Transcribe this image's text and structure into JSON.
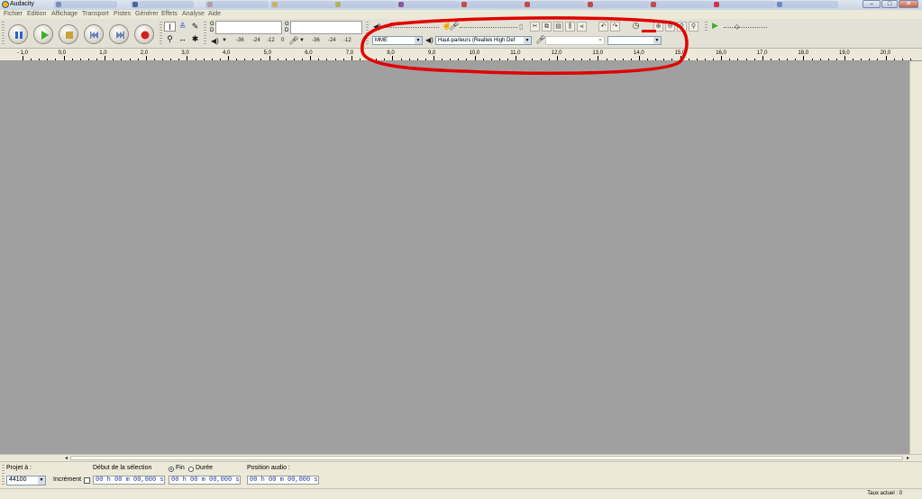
{
  "window": {
    "title": "Audacity",
    "minimize": "–",
    "maximize": "□",
    "close": "✕"
  },
  "menu": [
    {
      "label": "Fichier"
    },
    {
      "label": "Edition"
    },
    {
      "label": "Affichage"
    },
    {
      "label": "Transport"
    },
    {
      "label": "Pistes"
    },
    {
      "label": "Générer"
    },
    {
      "label": "Effets"
    },
    {
      "label": "Analyse"
    },
    {
      "label": "Aide"
    }
  ],
  "transport": {
    "pause_icon": "pause-icon",
    "play_icon": "play-icon",
    "stop_icon": "stop-icon",
    "skip_start_icon": "skip-start-icon",
    "skip_end_icon": "skip-end-icon",
    "record_icon": "record-icon"
  },
  "tools": {
    "selection": "I",
    "envelope": "≚",
    "draw": "✎",
    "zoom": "⚲",
    "timeshift": "↔",
    "multi": "✱"
  },
  "meters": {
    "playback_g": "G",
    "playback_d": "D",
    "record_g": "G",
    "record_d": "D",
    "scale": [
      "-36",
      "-24",
      "-12",
      "0"
    ],
    "record_scale": [
      "-36",
      "-24",
      "-12"
    ]
  },
  "device": {
    "host": "MME",
    "output": "Haut-parleurs (Realtek High Def",
    "input": "",
    "channels": ""
  },
  "ruler": {
    "labels": [
      "- 1,0",
      "0,0",
      "1,0",
      "2,0",
      "3,0",
      "4,0",
      "5,0",
      "6,0",
      "7,0",
      "8,0",
      "9,0",
      "10,0",
      "11,0",
      "12,0",
      "13,0",
      "14,0",
      "15,0",
      "16,0",
      "17,0",
      "18,0",
      "19,0",
      "20,0"
    ]
  },
  "selection_bar": {
    "project_rate_label": "Projet à :",
    "project_rate": "44100",
    "snap_label": "Incrément",
    "selection_start_label": "Début de la sélection",
    "end_label": "Fin",
    "length_label": "Durée",
    "audio_position_label": "Position audio :",
    "selection_start": "00 h 00 m 00,000 s",
    "selection_end": "00 h 00 m 00,000 s",
    "audio_position": "00 h 00 m 00,000 s"
  },
  "status": {
    "text": "Taux actuel : 0"
  },
  "colors": {
    "annotation": "#e00000",
    "track_background": "#a0a0a0",
    "play_green": "#3fae2a",
    "record_red": "#d42020",
    "pause_blue": "#2b63c4"
  }
}
